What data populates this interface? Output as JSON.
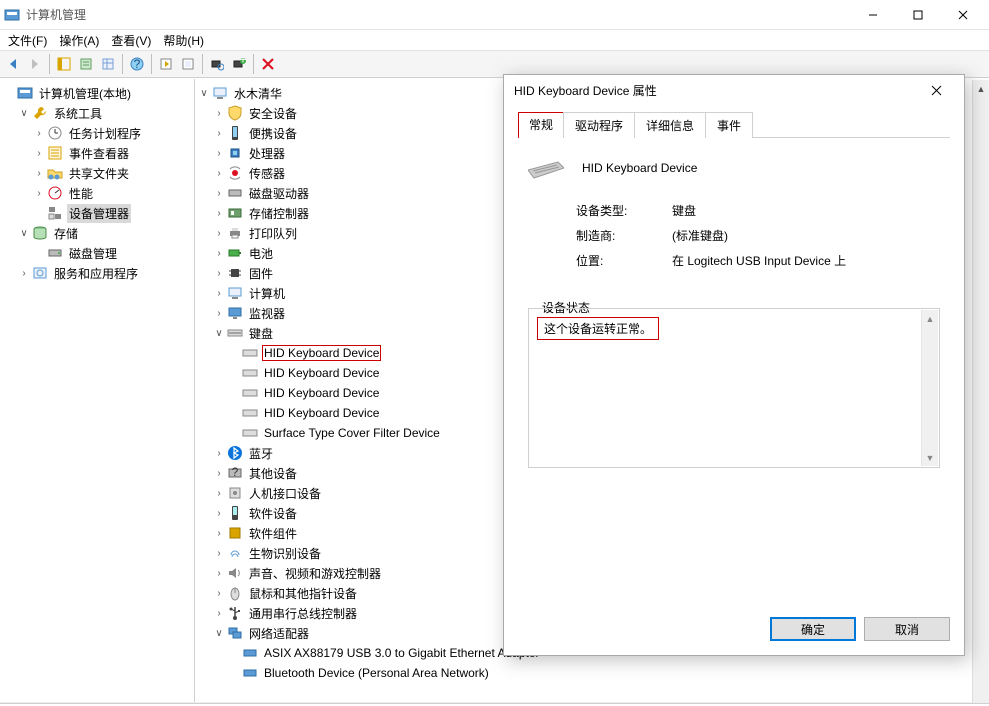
{
  "window": {
    "title": "计算机管理"
  },
  "menu": {
    "file": "文件(F)",
    "action": "操作(A)",
    "view": "查看(V)",
    "help": "帮助(H)"
  },
  "left_tree": {
    "root": "计算机管理(本地)",
    "systools": "系统工具",
    "task_scheduler": "任务计划程序",
    "event_viewer": "事件查看器",
    "shared_folders": "共享文件夹",
    "performance": "性能",
    "device_manager": "设备管理器",
    "storage": "存储",
    "disk_mgmt": "磁盘管理",
    "services_apps": "服务和应用程序"
  },
  "dev_tree": {
    "root": "水木清华",
    "security": "安全设备",
    "portable": "便携设备",
    "processors": "处理器",
    "sensors": "传感器",
    "disk_drives": "磁盘驱动器",
    "storage_ctrl": "存储控制器",
    "print_queues": "打印队列",
    "batteries": "电池",
    "firmware": "固件",
    "computer": "计算机",
    "monitors": "监视器",
    "keyboards": "键盘",
    "hid_kb_1": "HID Keyboard Device",
    "hid_kb_2": "HID Keyboard Device",
    "hid_kb_3": "HID Keyboard Device",
    "hid_kb_4": "HID Keyboard Device",
    "surface_filter": "Surface Type Cover Filter Device",
    "bluetooth": "蓝牙",
    "other": "其他设备",
    "hid": "人机接口设备",
    "software_dev": "软件设备",
    "software_comp": "软件组件",
    "biometric": "生物识别设备",
    "sound": "声音、视频和游戏控制器",
    "mice": "鼠标和其他指针设备",
    "usb_ctrl": "通用串行总线控制器",
    "net_adapters": "网络适配器",
    "asix": "ASIX AX88179 USB 3.0 to Gigabit Ethernet Adapter",
    "bt_pan": "Bluetooth Device (Personal Area Network)"
  },
  "dialog": {
    "title": "HID Keyboard Device 属性",
    "tabs": {
      "general": "常规",
      "driver": "驱动程序",
      "details": "详细信息",
      "events": "事件"
    },
    "device_name": "HID Keyboard Device",
    "type_label": "设备类型:",
    "type_value": "键盘",
    "mfr_label": "制造商:",
    "mfr_value": "(标准键盘)",
    "loc_label": "位置:",
    "loc_value": "在 Logitech USB Input Device 上",
    "status_label": "设备状态",
    "status_text": "这个设备运转正常。",
    "ok": "确定",
    "cancel": "取消"
  }
}
